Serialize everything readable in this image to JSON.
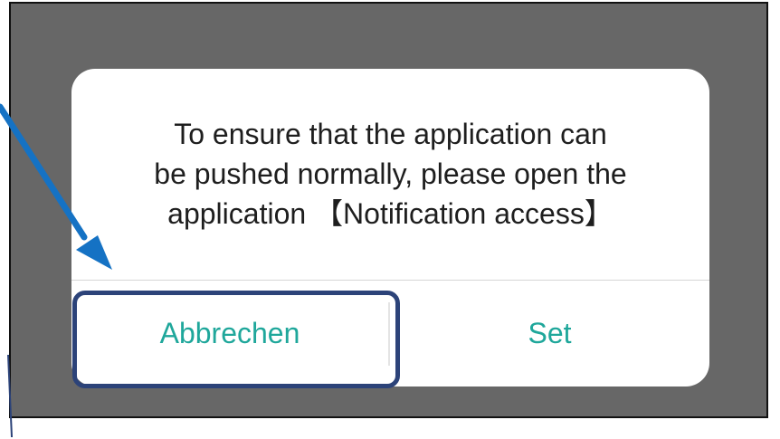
{
  "dialog": {
    "message_lines": [
      "To ensure that the application can",
      "be pushed normally, please open the",
      "application  【Notification access】"
    ],
    "cancel_label": "Abbrechen",
    "set_label": "Set"
  },
  "colors": {
    "overlay": "#676767",
    "dialog_background": "#ffffff",
    "message_text": "#1e1e1e",
    "button_text": "#1fa79b",
    "highlight_box": "#2c4379",
    "arrow": "#1572c4"
  },
  "annotations": {
    "arrow_icon": "arrow-pointing-icon",
    "highlight": "highlight-box"
  }
}
